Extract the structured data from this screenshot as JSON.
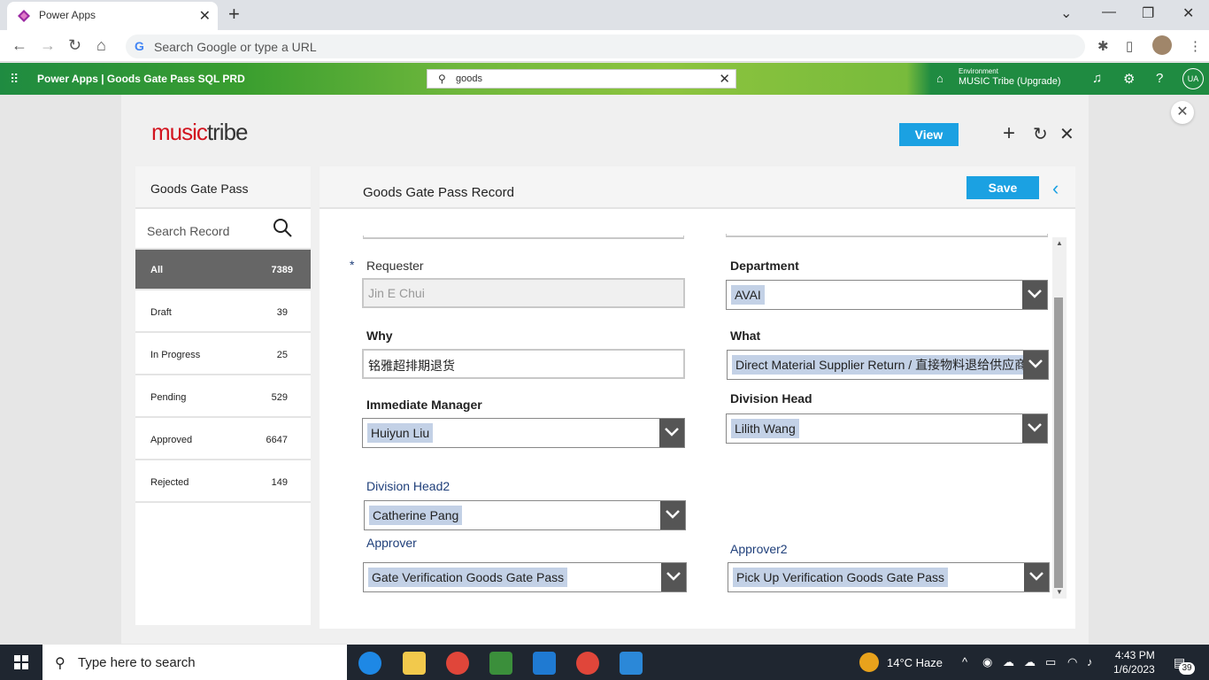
{
  "browser": {
    "tab_title": "Power Apps",
    "omnibox_placeholder": "Search Google or type a URL"
  },
  "powerapps": {
    "title": "Power Apps  |  Goods Gate Pass SQL PRD",
    "search_value": "goods",
    "env_label": "Environment",
    "env_name": "MUSIC Tribe (Upgrade)",
    "avatar_initials": "UA"
  },
  "app": {
    "logo_part1": "music",
    "logo_part2": "tribe",
    "view_label": "View",
    "brand_color": "#1ba1e2"
  },
  "sidebar": {
    "title": "Goods Gate Pass",
    "search_placeholder": "Search Record",
    "items": [
      {
        "label": "All",
        "count": "7389"
      },
      {
        "label": "Draft",
        "count": "39"
      },
      {
        "label": "In Progress",
        "count": "25"
      },
      {
        "label": "Pending",
        "count": "529"
      },
      {
        "label": "Approved",
        "count": "6647"
      },
      {
        "label": "Rejected",
        "count": "149"
      }
    ]
  },
  "form": {
    "title": "Goods Gate Pass Record",
    "save_label": "Save",
    "required_marker": "*",
    "requester": {
      "label": "Requester",
      "value": "Jin E Chui"
    },
    "department": {
      "label": "Department",
      "value": "AVAI"
    },
    "why": {
      "label": "Why",
      "value": "铭雅超排期退货"
    },
    "what": {
      "label": "What",
      "value": "Direct Material Supplier Return / 直接物料退给供应商"
    },
    "immediate_manager": {
      "label": "Immediate Manager",
      "value": "Huiyun Liu"
    },
    "division_head": {
      "label": "Division Head",
      "value": "Lilith Wang"
    },
    "division_head2": {
      "label": "Division Head2",
      "value": "Catherine Pang"
    },
    "approver": {
      "label": "Approver",
      "value": "Gate Verification Goods Gate Pass"
    },
    "approver2": {
      "label": "Approver2",
      "value": "Pick Up Verification Goods Gate Pass"
    }
  },
  "taskbar": {
    "search_text": "Type here to search",
    "weather": "14°C  Haze",
    "time": "4:43 PM",
    "date": "1/6/2023",
    "notification_count": "39"
  }
}
